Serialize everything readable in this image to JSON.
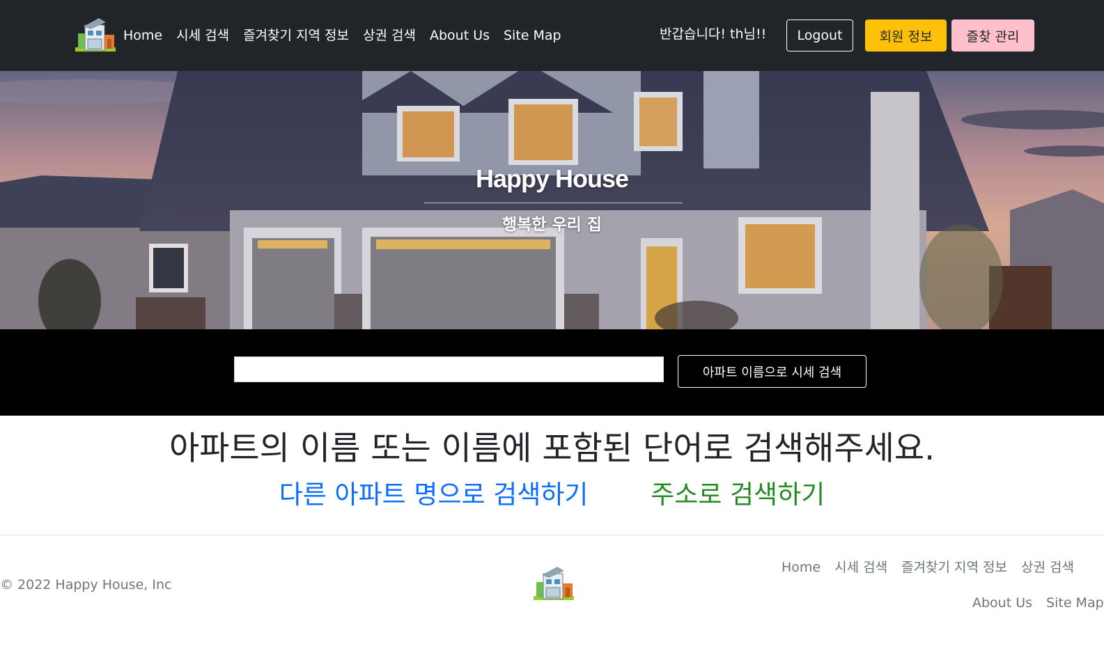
{
  "nav": {
    "logo_icon": "house-logo-icon",
    "links": [
      "Home",
      "시세 검색",
      "즐겨찾기 지역 정보",
      "상권 검색",
      "About Us",
      "Site Map"
    ],
    "greeting": "반갑습니다! th님!!",
    "logout_label": "Logout",
    "member_label": "회원 정보",
    "fav_label": "즐찾 관리"
  },
  "hero": {
    "title": "Happy House",
    "subtitle": "행복한 우리 집"
  },
  "search": {
    "input_value": "",
    "button_label": "아파트 이름으로 시세 검색"
  },
  "content": {
    "headline": "아파트의 이름 또는 이름에 포함된 단어로 검색해주세요.",
    "link_other_apt": "다른 아파트 명으로 검색하기",
    "link_address": "주소로 검색하기"
  },
  "footer": {
    "copyright": "© 2022 Happy House, Inc",
    "links_row1": [
      "Home",
      "시세 검색",
      "즐겨찾기 지역 정보",
      "상권 검색"
    ],
    "links_row2": [
      "About Us",
      "Site Map"
    ]
  },
  "colors": {
    "navbar_bg": "#212529",
    "member_button": "#ffc107",
    "fav_button": "#ffc0cb",
    "link_blue": "#0d6efd",
    "link_green": "#228B22"
  }
}
